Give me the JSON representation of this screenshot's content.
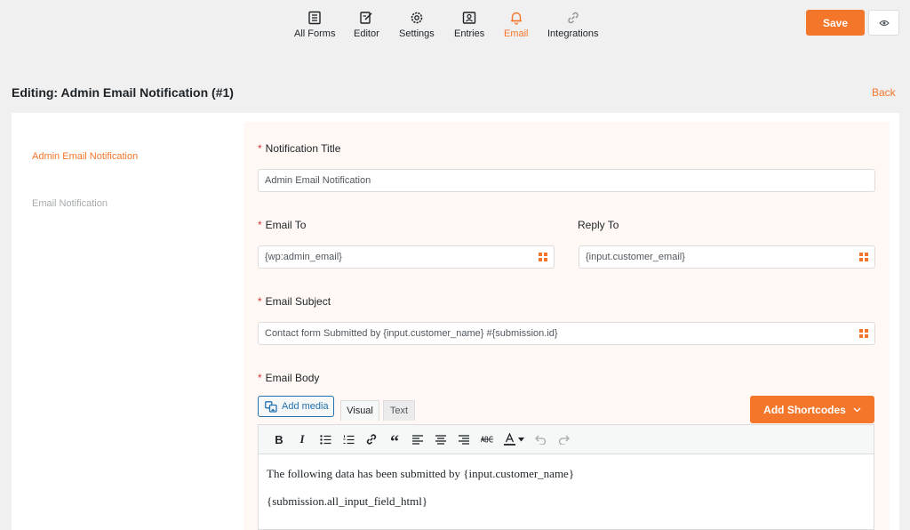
{
  "nav": {
    "items": [
      {
        "label": "All Forms",
        "icon": "forms-icon"
      },
      {
        "label": "Editor",
        "icon": "edit-icon"
      },
      {
        "label": "Settings",
        "icon": "gear-icon"
      },
      {
        "label": "Entries",
        "icon": "entries-icon"
      },
      {
        "label": "Email",
        "icon": "bell-icon"
      },
      {
        "label": "Integrations",
        "icon": "link-icon"
      }
    ],
    "active": "Email",
    "save_label": "Save"
  },
  "page": {
    "title": "Editing: Admin Email Notification (#1)",
    "back_label": "Back"
  },
  "sidebar": {
    "items": [
      {
        "label": "Admin Email Notification",
        "active": true
      },
      {
        "label": "Email Notification",
        "active": false
      }
    ]
  },
  "form": {
    "notification_title": {
      "label": "Notification Title",
      "required": "*",
      "value": "Admin Email Notification"
    },
    "email_to": {
      "label": "Email To",
      "required": "*",
      "value": "{wp:admin_email}"
    },
    "reply_to": {
      "label": "Reply To",
      "value": "{input.customer_email}"
    },
    "email_subject": {
      "label": "Email Subject",
      "required": "*",
      "value": "Contact form Submitted by {input.customer_name} #{submission.id}"
    },
    "email_body": {
      "label": "Email Body",
      "required": "*",
      "add_media_label": "Add media",
      "tab_visual": "Visual",
      "tab_text": "Text",
      "shortcodes_label": "Add Shortcodes",
      "lines": [
        "The following data has been submitted by {input.customer_name}",
        "{submission.all_input_field_html}"
      ]
    }
  },
  "colors": {
    "accent": "#f4762a",
    "link": "#2271b1",
    "required": "#d63638"
  }
}
